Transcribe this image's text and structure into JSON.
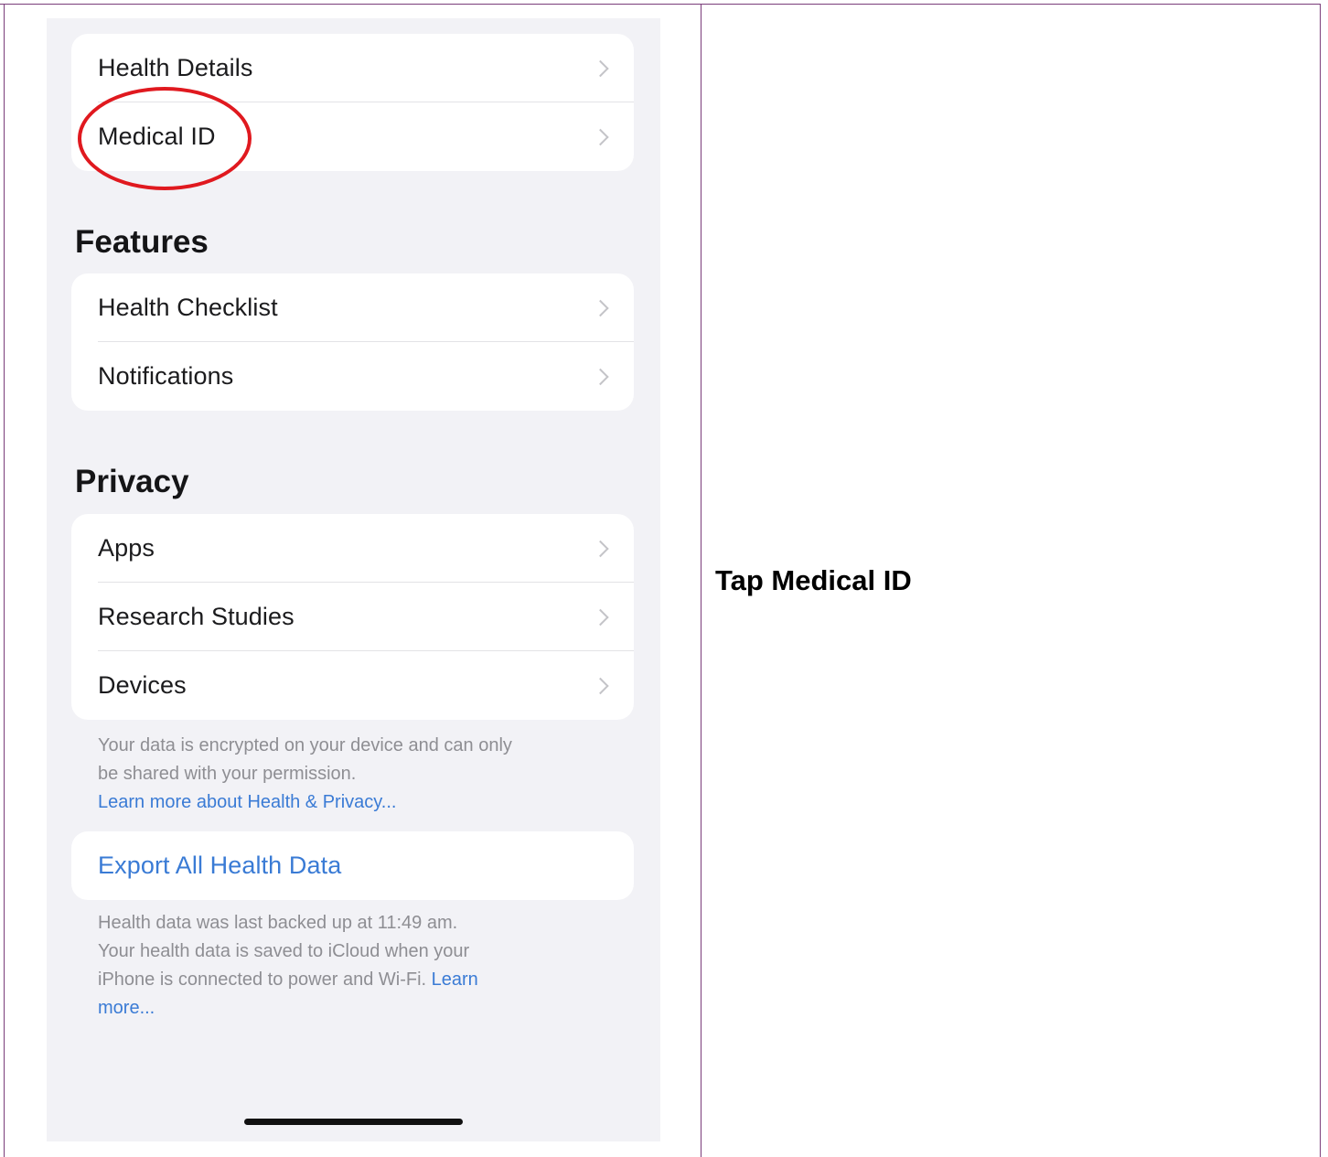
{
  "phone": {
    "top_group": {
      "items": [
        {
          "label": "Health Details"
        },
        {
          "label": "Medical ID"
        }
      ]
    },
    "features": {
      "heading": "Features",
      "items": [
        {
          "label": "Health Checklist"
        },
        {
          "label": "Notifications"
        }
      ]
    },
    "privacy": {
      "heading": "Privacy",
      "items": [
        {
          "label": "Apps"
        },
        {
          "label": "Research Studies"
        },
        {
          "label": "Devices"
        }
      ],
      "note_line1": "Your data is encrypted on your device and can only",
      "note_line2": "be shared with your permission.",
      "note_link": "Learn more about Health & Privacy..."
    },
    "export": {
      "label": "Export All Health Data"
    },
    "backup": {
      "line1": "Health data was last backed up at 11:49 am.",
      "line2": "Your health data is saved to iCloud when your",
      "line3_text": "iPhone is connected to power and Wi-Fi.",
      "line3_link": "Learn",
      "line4_link": "more..."
    }
  },
  "annotation": {
    "highlight_color": "#e0191f"
  },
  "instruction": {
    "text": "Tap Medical ID"
  },
  "colors": {
    "link_blue": "#3a7bd5",
    "table_border": "#7a3d7a",
    "screen_background": "#f2f2f6"
  }
}
